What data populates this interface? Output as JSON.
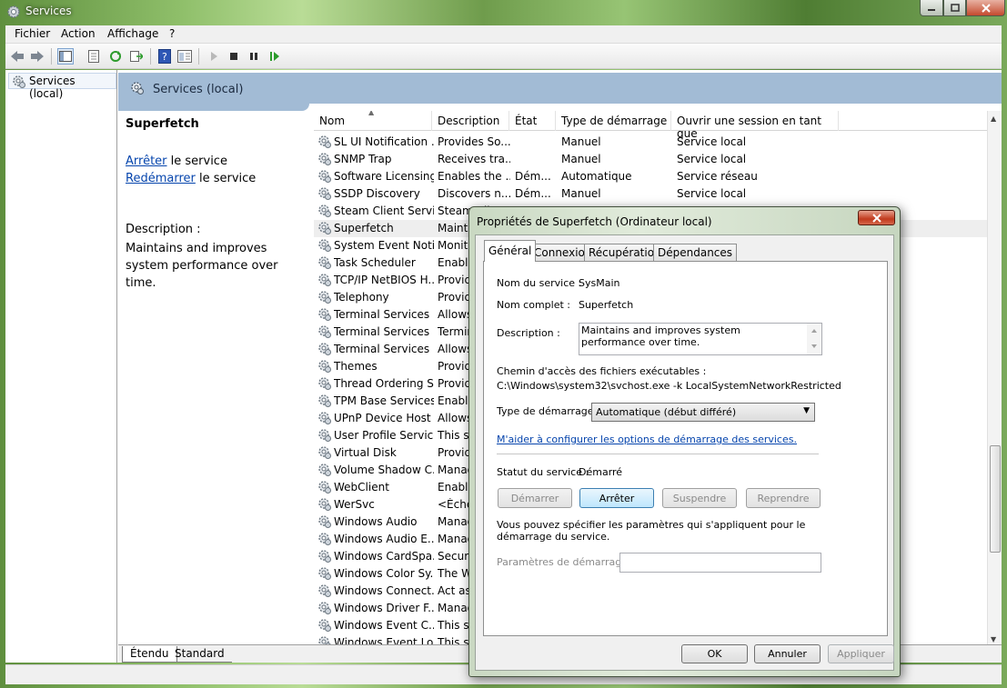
{
  "window": {
    "title": "Services"
  },
  "menu": [
    "Fichier",
    "Action",
    "Affichage",
    "?"
  ],
  "toolbar": {
    "icons": [
      "back-arrow-icon",
      "forward-arrow-icon",
      "show-hide-tree-icon",
      "properties-icon",
      "refresh-icon",
      "export-list-icon",
      "help-icon",
      "console-view-icon",
      "play-icon",
      "stop-icon",
      "pause-icon",
      "resume-icon"
    ]
  },
  "tree": {
    "item": "Services (local)"
  },
  "header": {
    "title": "Services (local)"
  },
  "extended": {
    "service_name": "Superfetch",
    "stop_link": "Arrêter",
    "stop_rest": " le service",
    "restart_link": "Redémarrer",
    "restart_rest": " le service",
    "description_label": "Description :",
    "description": "Maintains and improves system performance over time."
  },
  "columns": [
    "Nom",
    "Description",
    "État",
    "Type de démarrage",
    "Ouvrir une session en tant que"
  ],
  "rows": [
    {
      "name": "SL UI Notification ...",
      "desc": "Provides So...",
      "state": "",
      "start": "Manuel",
      "logon": "Service local"
    },
    {
      "name": "SNMP Trap",
      "desc": "Receives tra...",
      "state": "",
      "start": "Manuel",
      "logon": "Service local"
    },
    {
      "name": "Software Licensing",
      "desc": "Enables the ...",
      "state": "Dém...",
      "start": "Automatique",
      "logon": "Service réseau"
    },
    {
      "name": "SSDP Discovery",
      "desc": "Discovers n...",
      "state": "Dém...",
      "start": "Manuel",
      "logon": "Service local"
    },
    {
      "name": "Steam Client Servi...",
      "desc": "Steam Cli",
      "state": "",
      "start": "",
      "logon": ""
    },
    {
      "name": "Superfetch",
      "desc": "Mainta",
      "state": "",
      "start": "",
      "logon": ""
    },
    {
      "name": "System Event Noti...",
      "desc": "Monito",
      "state": "",
      "start": "",
      "logon": ""
    },
    {
      "name": "Task Scheduler",
      "desc": "Enable",
      "state": "",
      "start": "",
      "logon": ""
    },
    {
      "name": "TCP/IP NetBIOS H...",
      "desc": "Provid",
      "state": "",
      "start": "",
      "logon": ""
    },
    {
      "name": "Telephony",
      "desc": "Provid",
      "state": "",
      "start": "",
      "logon": ""
    },
    {
      "name": "Terminal Services",
      "desc": "Allows",
      "state": "",
      "start": "",
      "logon": ""
    },
    {
      "name": "Terminal Services ...",
      "desc": "Termin",
      "state": "",
      "start": "",
      "logon": ""
    },
    {
      "name": "Terminal Services ...",
      "desc": "Allows",
      "state": "",
      "start": "",
      "logon": ""
    },
    {
      "name": "Themes",
      "desc": "Provid",
      "state": "",
      "start": "",
      "logon": ""
    },
    {
      "name": "Thread Ordering S...",
      "desc": "Provid",
      "state": "",
      "start": "",
      "logon": ""
    },
    {
      "name": "TPM Base Services",
      "desc": "Enable",
      "state": "",
      "start": "",
      "logon": ""
    },
    {
      "name": "UPnP Device Host",
      "desc": "Allows",
      "state": "",
      "start": "",
      "logon": ""
    },
    {
      "name": "User Profile Service",
      "desc": "This se",
      "state": "",
      "start": "",
      "logon": ""
    },
    {
      "name": "Virtual Disk",
      "desc": "Provid",
      "state": "",
      "start": "",
      "logon": ""
    },
    {
      "name": "Volume Shadow C...",
      "desc": "Manag",
      "state": "",
      "start": "",
      "logon": ""
    },
    {
      "name": "WebClient",
      "desc": "Enable",
      "state": "",
      "start": "",
      "logon": ""
    },
    {
      "name": "WerSvc",
      "desc": "<Èche",
      "state": "",
      "start": "",
      "logon": ""
    },
    {
      "name": "Windows Audio",
      "desc": "Manag",
      "state": "",
      "start": "",
      "logon": ""
    },
    {
      "name": "Windows Audio E...",
      "desc": "Manag",
      "state": "",
      "start": "",
      "logon": ""
    },
    {
      "name": "Windows CardSpa...",
      "desc": "Secure",
      "state": "",
      "start": "",
      "logon": ""
    },
    {
      "name": "Windows Color Sy...",
      "desc": "The W",
      "state": "",
      "start": "",
      "logon": ""
    },
    {
      "name": "Windows Connect...",
      "desc": "Act as",
      "state": "",
      "start": "",
      "logon": ""
    },
    {
      "name": "Windows Driver F...",
      "desc": "Manag",
      "state": "",
      "start": "",
      "logon": ""
    },
    {
      "name": "Windows Event C...",
      "desc": "This se",
      "state": "",
      "start": "",
      "logon": ""
    },
    {
      "name": "Windows Event Log",
      "desc": "This se",
      "state": "",
      "start": "",
      "logon": ""
    }
  ],
  "selected_row": 5,
  "bottom_tabs": [
    "Étendu",
    "Standard"
  ],
  "dialog": {
    "title": "Propriétés de Superfetch (Ordinateur local)",
    "tabs": [
      "Général",
      "Connexion",
      "Récupération",
      "Dépendances"
    ],
    "service_name_label": "Nom du service :",
    "service_name": "SysMain",
    "display_name_label": "Nom complet :",
    "display_name": "Superfetch",
    "description_label": "Description :",
    "description": "Maintains and improves system performance over time.",
    "path_label": "Chemin d'accès des fichiers exécutables :",
    "path": "C:\\Windows\\system32\\svchost.exe -k LocalSystemNetworkRestricted",
    "startup_label": "Type de démarrage :",
    "startup_value": "Automatique (début différé)",
    "help_link": "M'aider à configurer les options de démarrage des services.",
    "status_label": "Statut du service :",
    "status_value": "Démarré",
    "buttons": {
      "start": "Démarrer",
      "stop": "Arrêter",
      "pause": "Suspendre",
      "resume": "Reprendre"
    },
    "params_note": "Vous pouvez spécifier les paramètres qui s'appliquent pour le démarrage du service.",
    "params_label": "Paramètres de démarrage :",
    "params_value": "",
    "ok": "OK",
    "cancel": "Annuler",
    "apply": "Appliquer"
  }
}
